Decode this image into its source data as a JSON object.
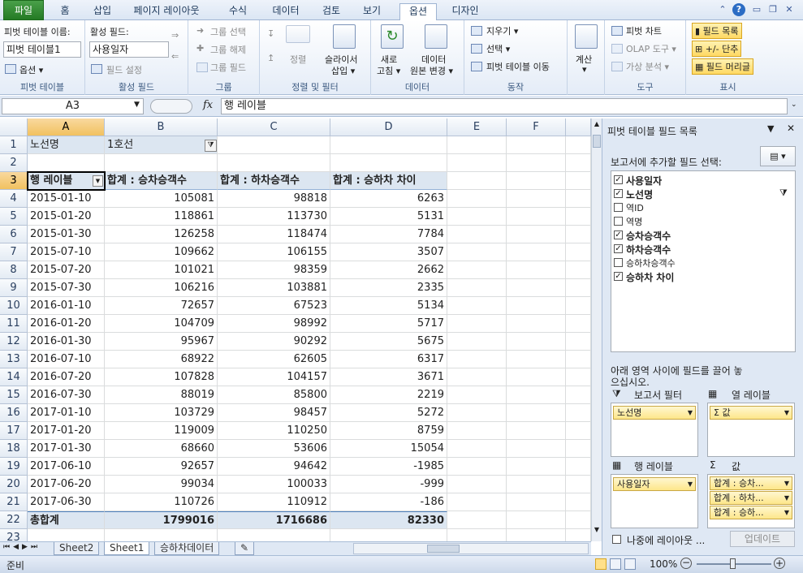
{
  "tabs": {
    "file": "파일",
    "home": "홈",
    "insert": "삽입",
    "page_layout": "페이지 레이아웃",
    "formulas": "수식",
    "data": "데이터",
    "review": "검토",
    "view": "보기",
    "options": "옵션",
    "design": "디자인"
  },
  "ribbon": {
    "pivot_name_label": "피벗 테이블 이름:",
    "pivot_name_value": "피벗 테이블1",
    "options_btn": "옵션 ▾",
    "grp_pivot": "피벗 테이블",
    "active_field_label": "활성 필드:",
    "active_field_value": "사용일자",
    "field_settings": "필드 설정",
    "grp_active": "활성 필드",
    "group_select": "그룹 선택",
    "group_ungroup": "그룹 해제",
    "group_field": "그룹 필드",
    "grp_group": "그룹",
    "sort": "정렬",
    "slicer_line1": "슬라이서",
    "slicer_line2": "삽입 ▾",
    "grp_sort": "정렬 및 필터",
    "refresh_line1": "새로",
    "refresh_line2": "고침 ▾",
    "change_src_line1": "데이터",
    "change_src_line2": "원본 변경 ▾",
    "grp_data": "데이터",
    "clear": "지우기 ▾",
    "select": "선택 ▾",
    "move_pivot": "피벗 테이블 이동",
    "grp_action": "동작",
    "calc_line1": "계산",
    "calc_line2": "▾",
    "pivot_chart": "피벗 차트",
    "olap": "OLAP 도구 ▾",
    "whatif": "가상 분석 ▾",
    "grp_tools": "도구",
    "field_list": "필드 목록",
    "plusminus": "+/- 단추",
    "field_headers": "필드 머리글",
    "grp_show": "표시"
  },
  "formula": {
    "namebox": "A3",
    "fx": "fx",
    "value": "행 레이블"
  },
  "columns": [
    "A",
    "B",
    "C",
    "D",
    "E",
    "F"
  ],
  "rows": [
    {
      "n": "1",
      "a": "노선명",
      "b": "1호선",
      "c": "",
      "d": ""
    },
    {
      "n": "2",
      "a": "",
      "b": "",
      "c": "",
      "d": ""
    },
    {
      "n": "3",
      "a": "행 레이블",
      "b": "합계 : 승차승객수",
      "c": "합계 : 하차승객수",
      "d": "합계 : 승하차 차이"
    },
    {
      "n": "4",
      "a": "2015-01-10",
      "b": "105081",
      "c": "98818",
      "d": "6263"
    },
    {
      "n": "5",
      "a": "2015-01-20",
      "b": "118861",
      "c": "113730",
      "d": "5131"
    },
    {
      "n": "6",
      "a": "2015-01-30",
      "b": "126258",
      "c": "118474",
      "d": "7784"
    },
    {
      "n": "7",
      "a": "2015-07-10",
      "b": "109662",
      "c": "106155",
      "d": "3507"
    },
    {
      "n": "8",
      "a": "2015-07-20",
      "b": "101021",
      "c": "98359",
      "d": "2662"
    },
    {
      "n": "9",
      "a": "2015-07-30",
      "b": "106216",
      "c": "103881",
      "d": "2335"
    },
    {
      "n": "10",
      "a": "2016-01-10",
      "b": "72657",
      "c": "67523",
      "d": "5134"
    },
    {
      "n": "11",
      "a": "2016-01-20",
      "b": "104709",
      "c": "98992",
      "d": "5717"
    },
    {
      "n": "12",
      "a": "2016-01-30",
      "b": "95967",
      "c": "90292",
      "d": "5675"
    },
    {
      "n": "13",
      "a": "2016-07-10",
      "b": "68922",
      "c": "62605",
      "d": "6317"
    },
    {
      "n": "14",
      "a": "2016-07-20",
      "b": "107828",
      "c": "104157",
      "d": "3671"
    },
    {
      "n": "15",
      "a": "2016-07-30",
      "b": "88019",
      "c": "85800",
      "d": "2219"
    },
    {
      "n": "16",
      "a": "2017-01-10",
      "b": "103729",
      "c": "98457",
      "d": "5272"
    },
    {
      "n": "17",
      "a": "2017-01-20",
      "b": "119009",
      "c": "110250",
      "d": "8759"
    },
    {
      "n": "18",
      "a": "2017-01-30",
      "b": "68660",
      "c": "53606",
      "d": "15054"
    },
    {
      "n": "19",
      "a": "2017-06-10",
      "b": "92657",
      "c": "94642",
      "d": "-1985"
    },
    {
      "n": "20",
      "a": "2017-06-20",
      "b": "99034",
      "c": "100033",
      "d": "-999"
    },
    {
      "n": "21",
      "a": "2017-06-30",
      "b": "110726",
      "c": "110912",
      "d": "-186"
    },
    {
      "n": "22",
      "a": "총합계",
      "b": "1799016",
      "c": "1716686",
      "d": "82330"
    },
    {
      "n": "23",
      "a": "",
      "b": "",
      "c": "",
      "d": ""
    }
  ],
  "sheets": [
    "Sheet2",
    "Sheet1",
    "승하차데이터"
  ],
  "status": {
    "ready": "준비",
    "zoom": "100%"
  },
  "pane": {
    "title": "피벗 테이블 필드 목록",
    "choose_label": "보고서에 추가할 필드 선택:",
    "fields": [
      {
        "name": "사용일자",
        "checked": true,
        "bold": true
      },
      {
        "name": "노선명",
        "checked": true,
        "bold": true
      },
      {
        "name": "역ID",
        "checked": false,
        "bold": false
      },
      {
        "name": "역명",
        "checked": false,
        "bold": false
      },
      {
        "name": "승차승객수",
        "checked": true,
        "bold": true
      },
      {
        "name": "하차승객수",
        "checked": true,
        "bold": true
      },
      {
        "name": "승하차승객수",
        "checked": false,
        "bold": false
      },
      {
        "name": "승하차 차이",
        "checked": true,
        "bold": true
      }
    ],
    "drag_label": "아래 영역 사이에 필드를 끌어 놓으십시오.",
    "report_filter": "보고서 필터",
    "col_labels": "열 레이블",
    "row_labels": "행 레이블",
    "values": "값",
    "filter_item": "노선명",
    "col_item": "Σ 값",
    "row_item": "사용일자",
    "value_items": [
      "합계 : 승차...",
      "합계 : 하차...",
      "합계 : 승하..."
    ],
    "defer": "나중에 레이아웃 ...",
    "update": "업데이트"
  }
}
